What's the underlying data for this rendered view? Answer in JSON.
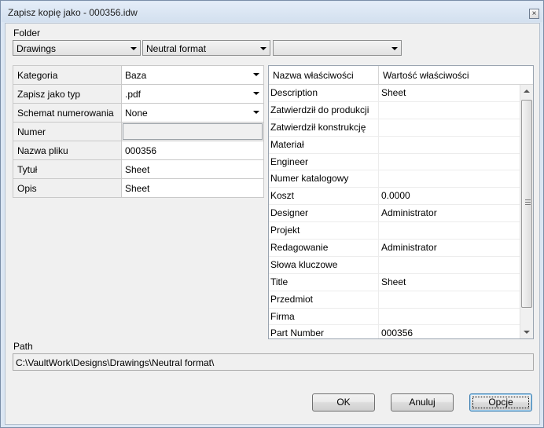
{
  "window": {
    "title": "Zapisz kopię jako - 000356.idw",
    "close_glyph": "×"
  },
  "folder": {
    "label": "Folder",
    "combo1": "Drawings",
    "combo2": "Neutral format",
    "combo3": ""
  },
  "settings": [
    {
      "key": "Kategoria",
      "value": "Baza",
      "type": "dropdown"
    },
    {
      "key": "Zapisz jako typ",
      "value": ".pdf",
      "type": "dropdown"
    },
    {
      "key": "Schemat numerowania",
      "value": "None",
      "type": "dropdown"
    },
    {
      "key": "Numer",
      "value": "",
      "type": "disabled"
    },
    {
      "key": "Nazwa pliku",
      "value": "000356",
      "type": "text"
    },
    {
      "key": "Tytuł",
      "value": "Sheet",
      "type": "text"
    },
    {
      "key": "Opis",
      "value": "Sheet",
      "type": "text"
    }
  ],
  "properties": {
    "header_name": "Nazwa właściwości",
    "header_value": "Wartość właściwości",
    "rows": [
      {
        "name": "Description",
        "value": "Sheet"
      },
      {
        "name": "Zatwierdził do produkcji",
        "value": ""
      },
      {
        "name": "Zatwierdził konstrukcję",
        "value": ""
      },
      {
        "name": "Materiał",
        "value": ""
      },
      {
        "name": "Engineer",
        "value": ""
      },
      {
        "name": "Numer katalogowy",
        "value": ""
      },
      {
        "name": "Koszt",
        "value": "0.0000"
      },
      {
        "name": "Designer",
        "value": "Administrator"
      },
      {
        "name": "Projekt",
        "value": ""
      },
      {
        "name": "Redagowanie",
        "value": "Administrator"
      },
      {
        "name": "Słowa kluczowe",
        "value": ""
      },
      {
        "name": "Title",
        "value": "Sheet"
      },
      {
        "name": "Przedmiot",
        "value": ""
      },
      {
        "name": "Firma",
        "value": ""
      },
      {
        "name": "Part Number",
        "value": "000356"
      }
    ]
  },
  "path": {
    "label": "Path",
    "value": "C:\\VaultWork\\Designs\\Drawings\\Neutral format\\"
  },
  "buttons": {
    "ok": "OK",
    "cancel": "Anuluj",
    "options": "Opcje"
  }
}
